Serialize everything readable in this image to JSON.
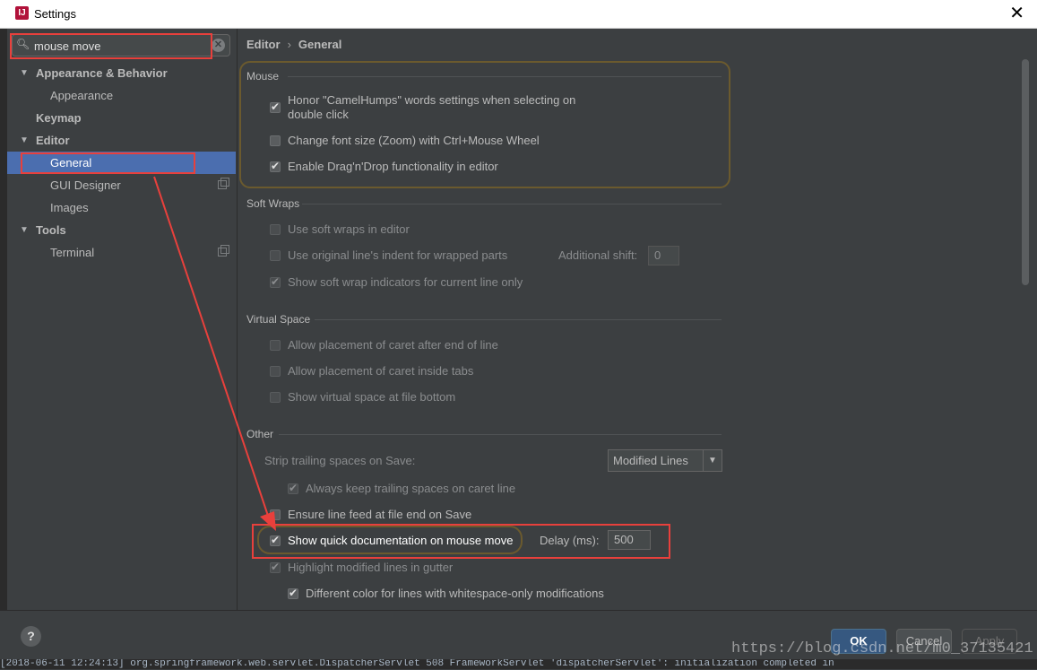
{
  "window": {
    "title": "Settings",
    "app_icon": "IJ",
    "close_glyph": "✕"
  },
  "search": {
    "value": "mouse move",
    "clear_glyph": "✕",
    "icon_glyph": "🔍︎"
  },
  "tree": {
    "items": [
      {
        "label": "Appearance & Behavior",
        "arrow": "▼"
      },
      {
        "label": "Appearance"
      },
      {
        "label": "Keymap"
      },
      {
        "label": "Editor",
        "arrow": "▼"
      },
      {
        "label": "General"
      },
      {
        "label": "GUI Designer"
      },
      {
        "label": "Images"
      },
      {
        "label": "Tools",
        "arrow": "▼"
      },
      {
        "label": "Terminal"
      }
    ]
  },
  "breadcrumb": {
    "first": "Editor",
    "sep": "›",
    "second": "General"
  },
  "groups": {
    "mouse": "Mouse",
    "soft_wraps": "Soft Wraps",
    "virtual_space": "Virtual Space",
    "other": "Other"
  },
  "mouse": {
    "camel_humps_line1": "Honor \"CamelHumps\" words settings when selecting on",
    "camel_humps_line2": "double click",
    "change_font_size": "Change font size (Zoom) with Ctrl+Mouse Wheel",
    "drag_n_drop": "Enable Drag'n'Drop functionality in editor"
  },
  "soft_wraps": {
    "use_soft_wraps": "Use soft wraps in editor",
    "use_original_indent": "Use original line's indent for wrapped parts",
    "additional_shift_label": "Additional shift:",
    "additional_shift_value": "0",
    "show_indicators": "Show soft wrap indicators for current line only"
  },
  "virtual_space": {
    "caret_after_end": "Allow placement of caret after end of line",
    "caret_inside_tabs": "Allow placement of caret inside tabs",
    "virtual_space_bottom": "Show virtual space at file bottom"
  },
  "other": {
    "strip_trailing_label": "Strip trailing spaces on Save:",
    "strip_trailing_value": "Modified Lines",
    "always_keep_trailing": "Always keep trailing spaces on caret line",
    "ensure_line_feed": "Ensure line feed at file end on Save",
    "show_quick_doc": "Show quick documentation on mouse move",
    "delay_label": "Delay (ms):",
    "delay_value": "500",
    "highlight_modified": "Highlight modified lines in gutter",
    "different_color": "Different color for lines with whitespace-only modifications"
  },
  "buttons": {
    "help": "?",
    "ok": "OK",
    "cancel": "Cancel",
    "apply": "Apply"
  },
  "console": {
    "line": "[2018-06-11 12:24:13] org.springframework.web.servlet.DispatcherServlet 508 FrameworkServlet 'dispatcherServlet': initialization completed in"
  },
  "watermark": "https://blog.csdn.net/m0_37135421",
  "colors": {
    "background": "#3c3f41",
    "selection": "#4b6eaf",
    "annotation_red": "#e8403c",
    "highlight_outline": "#6b5a2e",
    "ok_button": "#365880"
  }
}
